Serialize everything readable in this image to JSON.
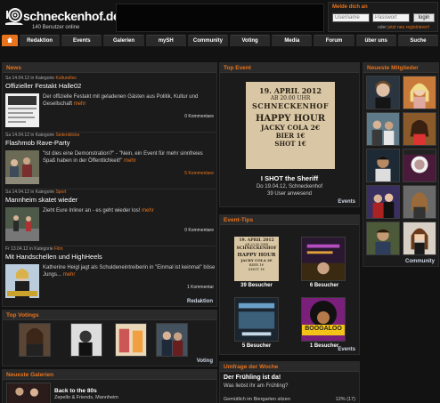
{
  "header": {
    "brand": "schneckenhof.de",
    "users_online": "140 Benutzer online"
  },
  "login": {
    "title": "Melde dich an",
    "username_placeholder": "Username",
    "password_placeholder": "Passwort",
    "button_label": "login",
    "register_prefix": "oder ",
    "register_link": "jetzt neu registrieren!"
  },
  "nav": {
    "items": [
      "Redaktion",
      "Events",
      "Galerien",
      "mySH",
      "Community",
      "Voting",
      "Media",
      "Forum",
      "über uns",
      "Suche"
    ]
  },
  "news": {
    "title": "News",
    "footer": "Redaktion",
    "items": [
      {
        "date": "Sa 14.04.12 in Kategorie",
        "category": "Kulturelles",
        "title": "Offizieller Festakt Halle02",
        "text": "Der offizielle Festakt mit geladenen Gästen aus Politik, Kultur und Gesellschaft",
        "more": "mehr",
        "comments": "0 Kommentare"
      },
      {
        "date": "Sa 14.04.12 in Kategorie",
        "category": "Seitenblicke",
        "title": "Flashmob Rave-Party",
        "text": "\"Ist dies eine Demonstration?\" - \"Nein, ein Event für mehr sinnfreies Spaß haben in der Öffentlichkeit!\"",
        "more": "mehr",
        "comments": "5 Kommentare"
      },
      {
        "date": "Sa 14.04.12 in Kategorie",
        "category": "Sport",
        "title": "Mannheim skatet wieder",
        "text": "Zieht Eure Inliner an - es geht wieder los!",
        "more": "mehr",
        "comments": "0 Kommentare"
      },
      {
        "date": "Fr 13.04.12 in Kategorie",
        "category": "Film",
        "title": "Mit Handschellen und HighHeels",
        "text": "Katherine Heigl jagt als Schuldeneintreiberin in \"Einmal ist keinmal\" böse Jungs...",
        "more": "mehr",
        "comments": "1 Kommentar"
      }
    ]
  },
  "top_event": {
    "title": "Top Event",
    "poster_lines": [
      "19. APRIL 2012",
      "AB 20.00 UHR",
      "SCHNECKENHOF",
      "HAPPY HOUR",
      "JACKY COLA 2€",
      "BIER 1€",
      "SHOT 1€"
    ],
    "name": "I SHOT the Sheriff",
    "date_place": "Do 19.04.12, Schneckenhof",
    "attendees": "39 User anwesend",
    "footer": "Events"
  },
  "event_tips": {
    "title": "Event-Tips",
    "footer": "Events",
    "items": [
      {
        "label": "39 Besucher",
        "poster": [
          "19. APRIL 2012",
          "AB 20.00 UHR",
          "SCHNECKENHOF",
          "HAPPY HOUR",
          "JACKY COLA 2€",
          "BIER 1€",
          "SHOT 1€"
        ]
      },
      {
        "label": "6 Besucher"
      },
      {
        "label": "5 Besucher"
      },
      {
        "label": "1 Besucher",
        "poster_text": "BOOGALOO"
      }
    ]
  },
  "members": {
    "title": "Neueste Mitglieder",
    "footer": "Community",
    "count": 12
  },
  "top_votings": {
    "title": "Top Votings",
    "footer": "Voting"
  },
  "poll": {
    "title": "Umfrage der Woche",
    "heading": "Der Frühling ist da!",
    "question": "Was liebst ihr am Frühling?",
    "option": "Gemütlich im Biergarten sitzen",
    "result": "12% (17)"
  },
  "galleries": {
    "title": "Neueste Galerien",
    "item_title": "Back to the 80s",
    "item_place": "Zepello & Friends, Mannheim"
  },
  "colors": {
    "accent": "#e8731d",
    "background": "#121212",
    "panel": "#1b1b1b",
    "header": "#2a2a2a"
  }
}
